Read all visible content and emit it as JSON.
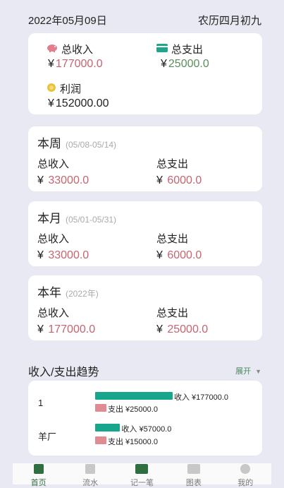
{
  "header": {
    "date": "2022年05月09日",
    "lunar": "农历四月初九"
  },
  "currency": "¥",
  "summary": {
    "income_label": "总收入",
    "income_value": "177000.0",
    "expense_label": "总支出",
    "expense_value": "25000.0",
    "profit_label": "利润",
    "profit_value": "152000.00"
  },
  "periods": [
    {
      "title": "本周",
      "range": "(05/08-05/14)",
      "income_label": "总收入",
      "income_value": "33000.0",
      "expense_label": "总支出",
      "expense_value": "6000.0"
    },
    {
      "title": "本月",
      "range": "(05/01-05/31)",
      "income_label": "总收入",
      "income_value": "33000.0",
      "expense_label": "总支出",
      "expense_value": "6000.0"
    },
    {
      "title": "本年",
      "range": "(2022年)",
      "income_label": "总收入",
      "income_value": "177000.0",
      "expense_label": "总支出",
      "expense_value": "25000.0"
    }
  ],
  "trend": {
    "title": "收入/支出趋势",
    "expand_label": "展开",
    "rows": [
      {
        "name": "1",
        "income_text": "收入 ¥177000.0",
        "expense_text": "支出 ¥25000.0"
      },
      {
        "name": "羊厂",
        "income_text": "收入 ¥57000.0",
        "expense_text": "支出 ¥15000.0"
      }
    ]
  },
  "chart_data": {
    "type": "bar",
    "categories": [
      "1",
      "羊厂"
    ],
    "series": [
      {
        "name": "收入",
        "values": [
          177000.0,
          57000.0
        ]
      },
      {
        "name": "支出",
        "values": [
          25000.0,
          15000.0
        ]
      }
    ]
  },
  "colors": {
    "income": "#17a58c",
    "expense": "#e08b92",
    "accent": "#2f6f3f"
  },
  "tabs": [
    {
      "label": "首页",
      "icon": "home-icon"
    },
    {
      "label": "流水",
      "icon": "list-icon"
    },
    {
      "label": "记一笔",
      "icon": "add-icon"
    },
    {
      "label": "图表",
      "icon": "chart-icon"
    },
    {
      "label": "我的",
      "icon": "user-icon"
    }
  ]
}
